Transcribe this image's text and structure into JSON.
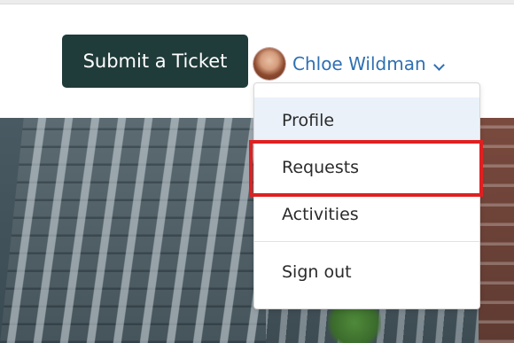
{
  "header": {
    "submit_label": "Submit a Ticket",
    "user_name": "Chloe Wildman"
  },
  "icons": {
    "avatar": "user-avatar-photo",
    "chevron": "chevron-down-icon"
  },
  "dropdown": {
    "items": [
      {
        "label": "Profile",
        "active": true
      },
      {
        "label": "Requests",
        "active": false
      },
      {
        "label": "Activities",
        "active": false
      },
      {
        "label": "Sign out",
        "active": false
      }
    ]
  },
  "colors": {
    "button_bg": "#1f3b3a",
    "link_blue": "#2f6fb3",
    "highlight_red": "#e02020",
    "active_item_bg": "#eaf1f9"
  }
}
